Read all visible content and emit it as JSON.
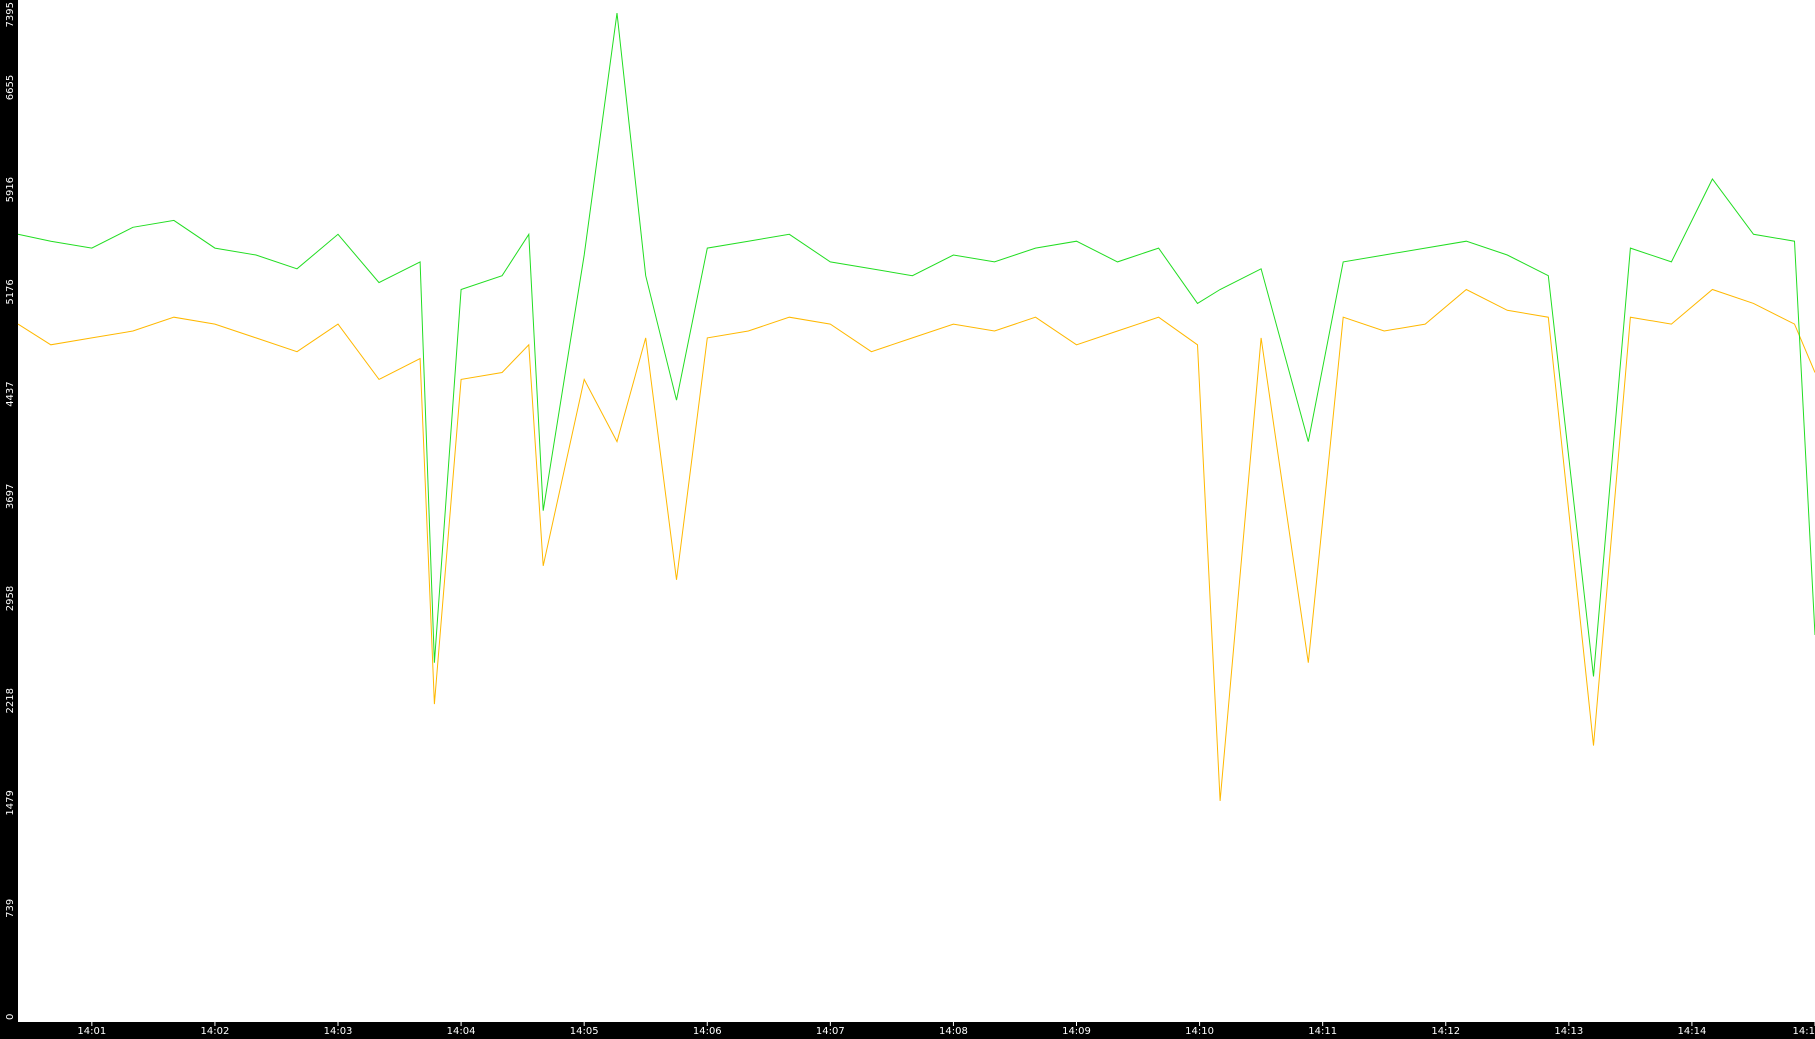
{
  "colors": {
    "background": "#000000",
    "plot_background": "#ffffff",
    "axis_text": "#ffffff"
  },
  "chart_data": {
    "type": "line",
    "title": "",
    "xlabel": "",
    "ylabel": "",
    "grid": false,
    "legend": "none",
    "xlim": [
      "14:00:24",
      "14:15:00"
    ],
    "ylim": [
      0,
      7395
    ],
    "x_ticks": [
      "14:01",
      "14:02",
      "14:03",
      "14:04",
      "14:05",
      "14:06",
      "14:07",
      "14:08",
      "14:09",
      "14:10",
      "14:11",
      "14:12",
      "14:13",
      "14:14",
      "14:1"
    ],
    "y_ticks": [
      "0",
      "739",
      "1479",
      "2218",
      "2958",
      "3697",
      "4437",
      "5176",
      "5916",
      "6655",
      "7395"
    ],
    "x": [
      "14:00:24",
      "14:00:40",
      "14:01:00",
      "14:01:20",
      "14:01:40",
      "14:02:00",
      "14:02:20",
      "14:02:40",
      "14:03:00",
      "14:03:20",
      "14:03:40",
      "14:03:47",
      "14:04:00",
      "14:04:20",
      "14:04:33",
      "14:04:40",
      "14:05:00",
      "14:05:16",
      "14:05:30",
      "14:05:45",
      "14:06:00",
      "14:06:20",
      "14:06:40",
      "14:07:00",
      "14:07:20",
      "14:07:40",
      "14:08:00",
      "14:08:20",
      "14:08:40",
      "14:09:00",
      "14:09:20",
      "14:09:40",
      "14:09:59",
      "14:10:10",
      "14:10:30",
      "14:10:53",
      "14:11:10",
      "14:11:30",
      "14:11:50",
      "14:12:10",
      "14:12:30",
      "14:12:50",
      "14:13:12",
      "14:13:30",
      "14:13:50",
      "14:14:10",
      "14:14:30",
      "14:14:50",
      "14:15:00"
    ],
    "series": [
      {
        "color": "#22dd22",
        "values": [
          5700,
          5650,
          5600,
          5750,
          5800,
          5600,
          5550,
          5450,
          5700,
          5350,
          5500,
          2600,
          5300,
          5400,
          5700,
          3700,
          5550,
          7300,
          5400,
          4500,
          5600,
          5650,
          5700,
          5500,
          5450,
          5400,
          5550,
          5500,
          5600,
          5650,
          5500,
          5600,
          5200,
          5300,
          5450,
          4200,
          5500,
          5550,
          5600,
          5650,
          5550,
          5400,
          2500,
          5600,
          5500,
          6100,
          5700,
          5650,
          2800
        ]
      },
      {
        "color": "#ffb800",
        "values": [
          5050,
          4900,
          4950,
          5000,
          5100,
          5050,
          4950,
          4850,
          5050,
          4650,
          4800,
          2300,
          4650,
          4700,
          4900,
          3300,
          4650,
          4200,
          4950,
          3200,
          4950,
          5000,
          5100,
          5050,
          4850,
          4950,
          5050,
          5000,
          5100,
          4900,
          5000,
          5100,
          4900,
          1600,
          4950,
          2600,
          5100,
          5000,
          5050,
          5300,
          5150,
          5100,
          2000,
          5100,
          5050,
          5300,
          5200,
          5050,
          4700
        ]
      }
    ]
  }
}
